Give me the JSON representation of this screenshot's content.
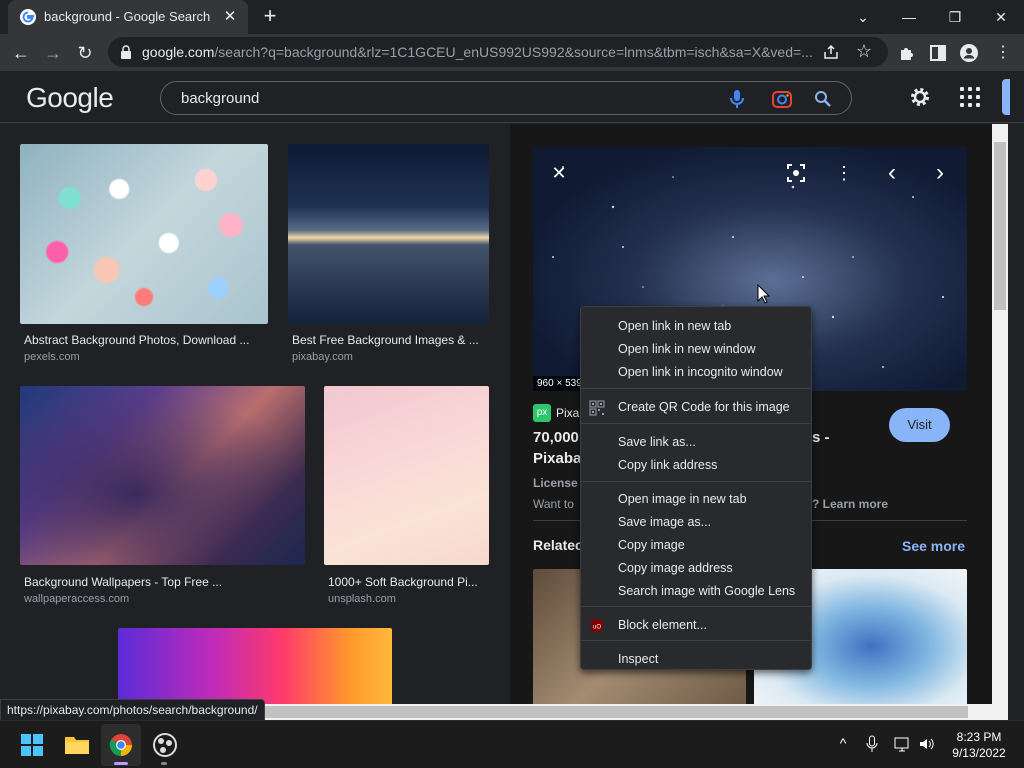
{
  "browser": {
    "tab": {
      "title": "background - Google Search",
      "close_glyph": "✕"
    },
    "newtab_glyph": "+",
    "window_controls": {
      "dropdown": "⌄",
      "minimize": "—",
      "restore": "❐",
      "close": "✕"
    },
    "url": {
      "host": "google.com",
      "path": "/search?q=background&rlz=1C1GCEU_enUS992US992&source=lnms&tbm=isch&sa=X&ved=..."
    },
    "nav": {
      "back": "←",
      "forward": "→",
      "reload": "↻"
    },
    "star_glyph": "☆"
  },
  "google": {
    "logo": "Google",
    "query": "background"
  },
  "results": [
    {
      "caption": "Abstract Background Photos, Download ...",
      "source": "pexels.com"
    },
    {
      "caption": "Best Free Background Images & ...",
      "source": "pixabay.com"
    },
    {
      "caption": "Background Wallpapers - Top Free ...",
      "source": "wallpaperaccess.com"
    },
    {
      "caption": "1000+ Soft Background Pi...",
      "source": "unsplash.com"
    }
  ],
  "panel": {
    "dimensions": "960 × 539",
    "site_name": "Pixab",
    "site_badge": "px",
    "title_line1": "70,000",
    "title_line1_tail": "s -",
    "title_line2": "Pixaba",
    "license": "License",
    "want_to": "Want to",
    "learn_more": "? Learn more",
    "visit": "Visit",
    "related": "Relatec",
    "see_more": "See more",
    "close_glyph": "✕",
    "more_glyph": "⋮",
    "prev_glyph": "‹",
    "next_glyph": "›"
  },
  "context_menu": {
    "items": [
      "Open link in new tab",
      "Open link in new window",
      "Open link in incognito window",
      "Create QR Code for this image",
      "Save link as...",
      "Copy link address",
      "Open image in new tab",
      "Save image as...",
      "Copy image",
      "Copy image address",
      "Search image with Google Lens",
      "Block element...",
      "Inspect"
    ]
  },
  "status_url": "https://pixabay.com/photos/search/background/",
  "taskbar": {
    "time": "8:23 PM",
    "date": "9/13/2022",
    "chevron": "^"
  },
  "colors": {
    "accent": "#8ab4f8",
    "background": "#202124",
    "menu": "#292a2d"
  }
}
